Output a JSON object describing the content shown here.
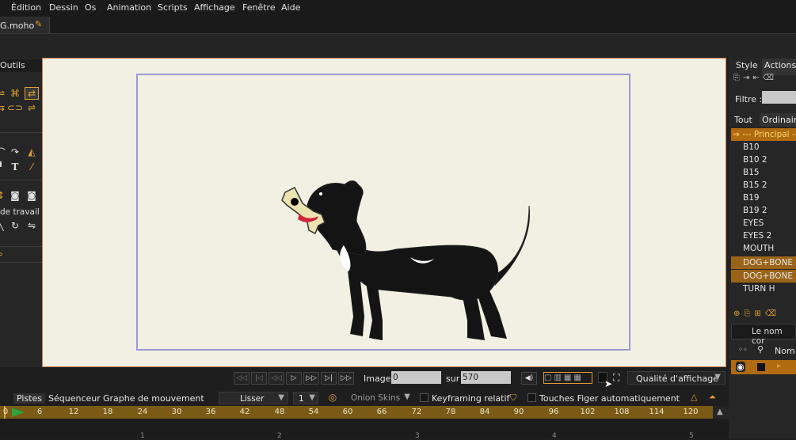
{
  "menu": [
    "Édition",
    "Dessin",
    "Os",
    "Animation",
    "Scripts",
    "Affichage",
    "Fenêtre",
    "Aide"
  ],
  "document_tab": "G.moho",
  "tools_panel": {
    "header": "Outils",
    "section_label": "de travail"
  },
  "right_panel": {
    "tabs": [
      "Style",
      "Actions"
    ],
    "filter_label": "Filtre :",
    "sub_tabs": [
      "Tout",
      "Ordinaire"
    ],
    "main_layer": "--- Principal --",
    "actions": [
      "B10",
      "B10 2",
      "B15",
      "B15 2",
      "B19",
      "B19 2",
      "EYES",
      "EYES 2",
      "MOUTH",
      "DOG+BONE",
      "DOG+BONE 2",
      "TURN H"
    ],
    "highlighted": [
      "DOG+BONE",
      "DOG+BONE 2"
    ],
    "name_placeholder": "Le nom cor",
    "layers_header": "Nom"
  },
  "playback": {
    "image_label": "Image",
    "image_value": "0",
    "sur_label": "sur",
    "sur_value": "570",
    "quality_label": "Qualité d'affichage"
  },
  "timeline": {
    "tabs": [
      "Pistes",
      "Séquenceur",
      "Graphe de mouvement"
    ],
    "smooth": "Lisser",
    "smooth_value": "1",
    "onion": "Onion Skins",
    "keyframing": "Keyframing relatif",
    "auto_freeze": "Touches Figer automatiquement",
    "ruler": [
      "0",
      "6",
      "12",
      "18",
      "24",
      "30",
      "36",
      "42",
      "48",
      "54",
      "60",
      "66",
      "72",
      "78",
      "84",
      "90",
      "96",
      "102",
      "108",
      "114",
      "120"
    ],
    "bottom_marks": [
      "1",
      "2",
      "3",
      "4",
      "5"
    ]
  },
  "colors": {
    "accent": "#e0a030",
    "canvas": "#f1f0e3",
    "frame": "#9a9ad0",
    "timeline_ruler": "#7a5a14"
  }
}
